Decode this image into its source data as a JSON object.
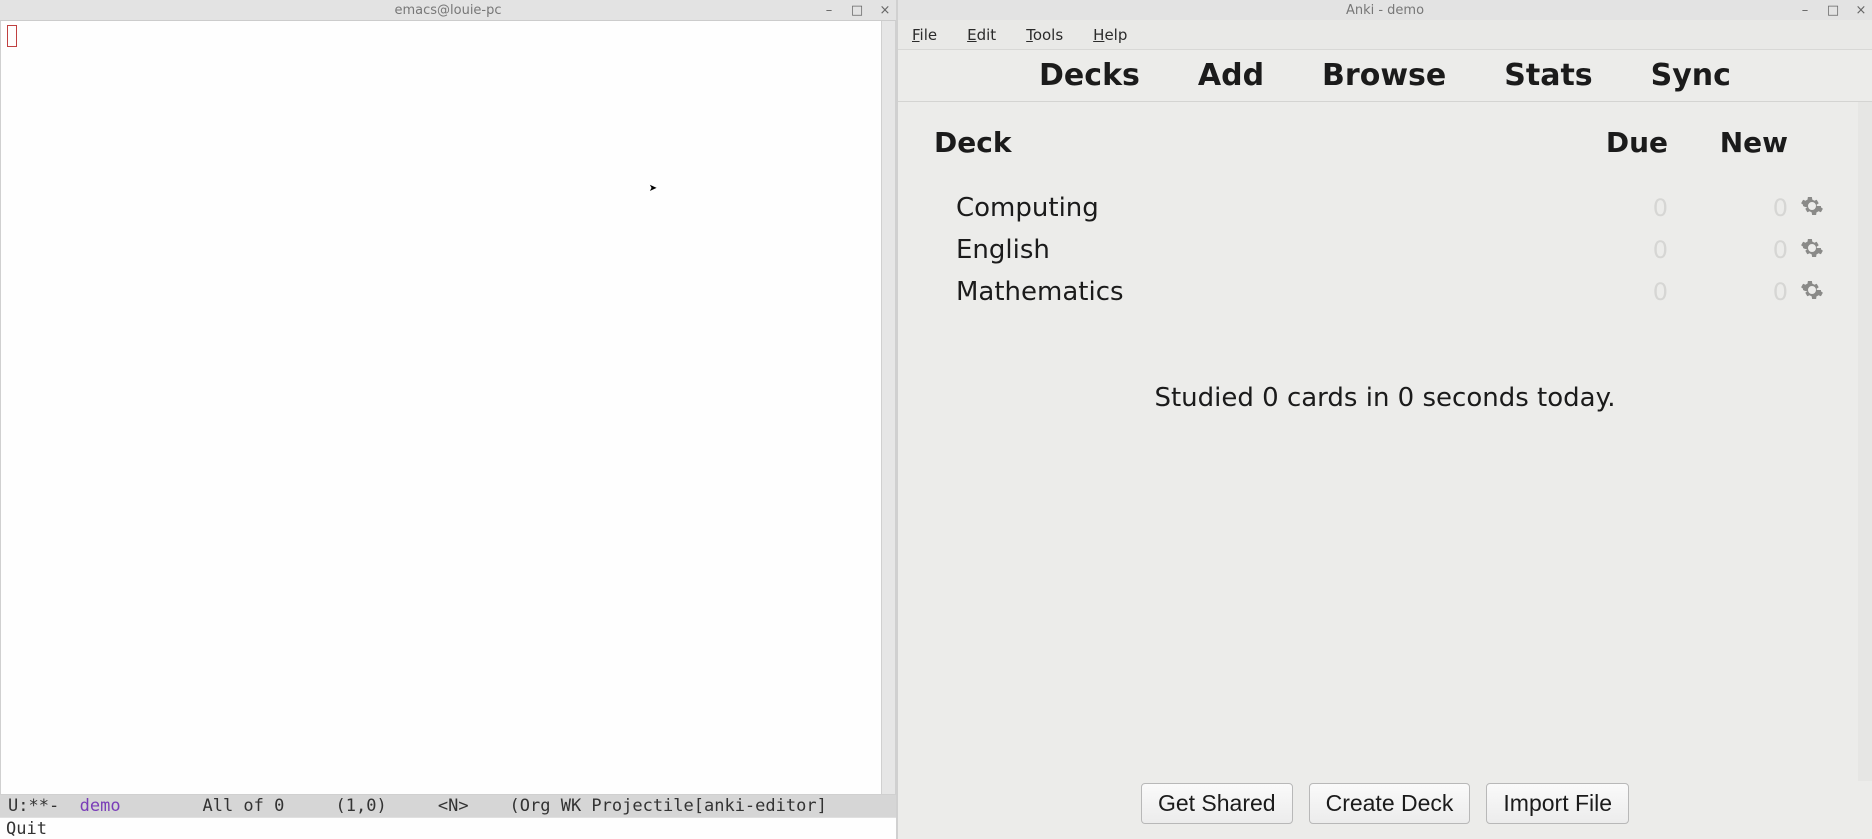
{
  "emacs": {
    "title": "emacs@louie-pc",
    "modeline": {
      "left": "U:**-  ",
      "buffer": "demo",
      "middle": "        All of 0     (1,0)     <N>    (Org WK Projectile[anki-editor]"
    },
    "minibuffer": "Quit"
  },
  "anki": {
    "title": "Anki - demo",
    "menu": {
      "file": "File",
      "edit": "Edit",
      "tools": "Tools",
      "help": "Help"
    },
    "toolbar": {
      "decks": "Decks",
      "add": "Add",
      "browse": "Browse",
      "stats": "Stats",
      "sync": "Sync"
    },
    "headers": {
      "deck": "Deck",
      "due": "Due",
      "new": "New"
    },
    "decks": [
      {
        "name": "Computing",
        "due": "0",
        "new": "0"
      },
      {
        "name": "English",
        "due": "0",
        "new": "0"
      },
      {
        "name": "Mathematics",
        "due": "0",
        "new": "0"
      }
    ],
    "studied": "Studied 0 cards in 0 seconds today.",
    "bottom": {
      "shared": "Get Shared",
      "create": "Create Deck",
      "import": "Import File"
    }
  }
}
